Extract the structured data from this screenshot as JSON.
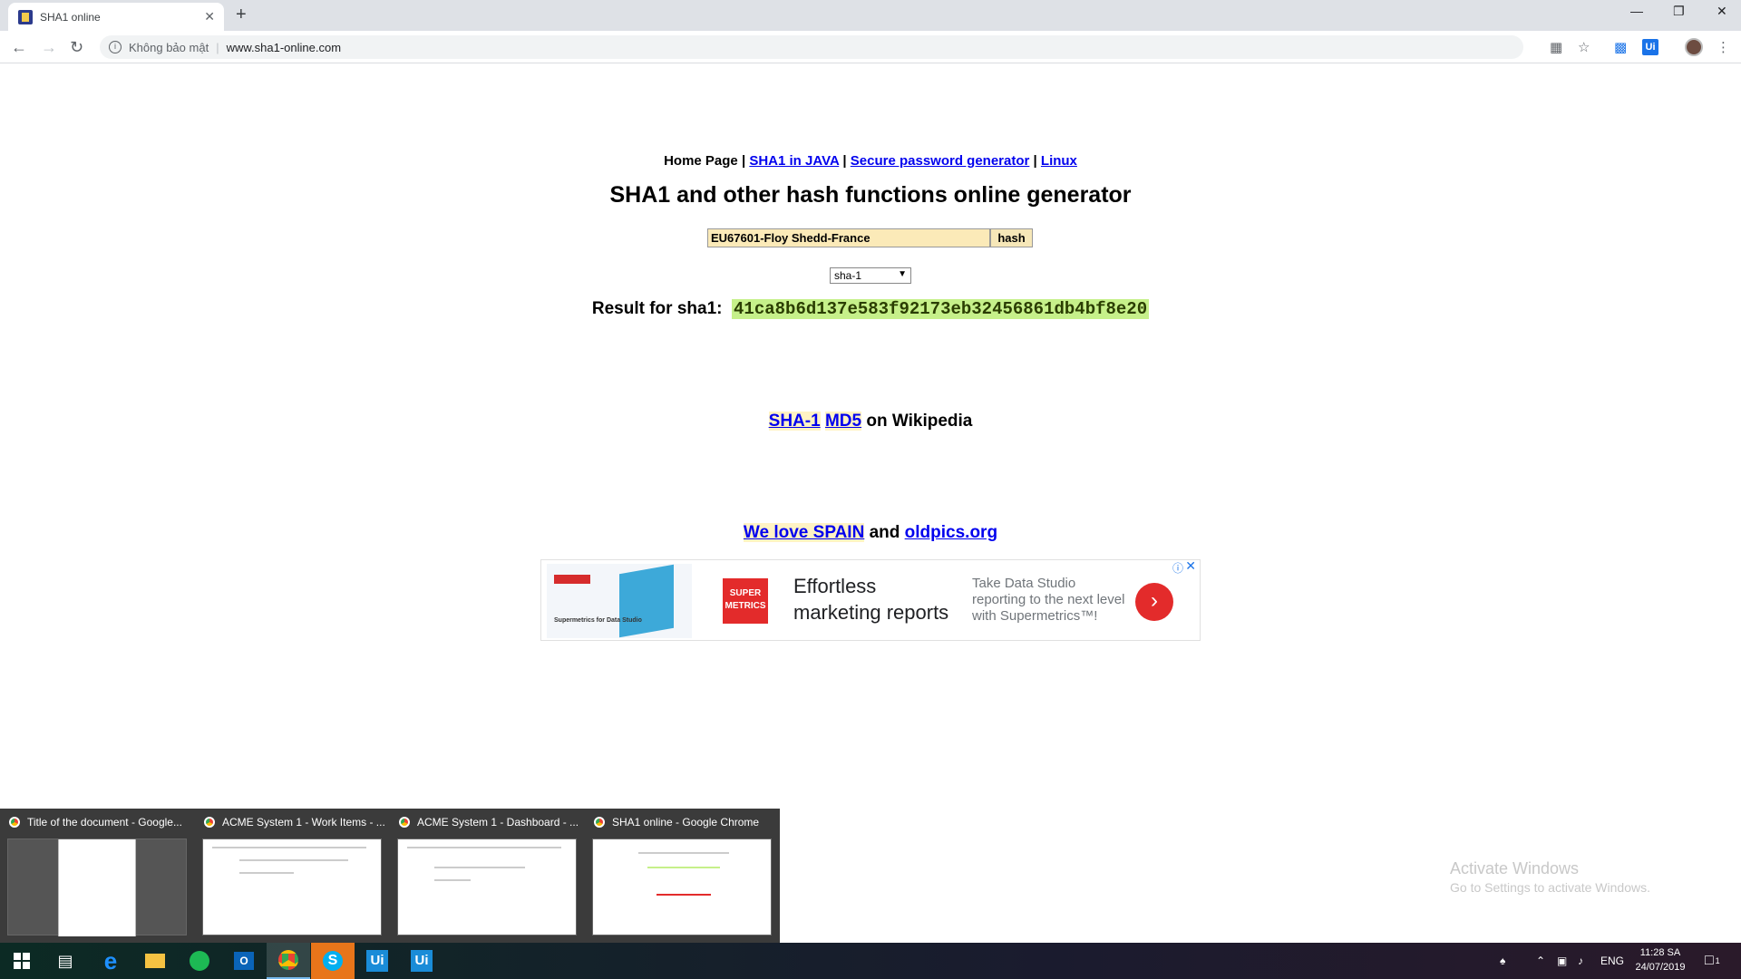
{
  "browser": {
    "tab_title": "SHA1 online",
    "tab_close": "✕",
    "new_tab": "+",
    "security_label": "Không bảo mật",
    "url": "www.sha1-online.com",
    "ext_label": "Ui"
  },
  "page": {
    "nav": {
      "home": "Home Page",
      "sep": "|",
      "sha1_java": "SHA1 in JAVA",
      "password_gen": "Secure password generator",
      "linux": "Linux"
    },
    "title": "SHA1 and other hash functions online generator",
    "input_value": "EU67601-Floy Shedd-France",
    "hash_button": "hash",
    "algorithm_selected": "sha-1",
    "result_label": "Result for sha1:",
    "result_hash": "41ca8b6d137e583f92173eb32456861db4bf8e20",
    "wiki": {
      "sha1": "SHA-1",
      "md5": "MD5",
      "suffix": "on Wikipedia"
    },
    "love": {
      "spain": "We love SPAIN",
      "and": "and",
      "oldpics": "oldpics.org"
    },
    "ad": {
      "thumb_caption": "Supermetrics for Data Studio",
      "logo_text": "SUPER METRICS",
      "headline_line1": "Effortless",
      "headline_line2": "marketing reports",
      "description": "Take Data Studio reporting to the next level with Supermetrics™!",
      "arrow": "›",
      "info": "ⓘ",
      "close": "✕"
    }
  },
  "thumbnails": [
    {
      "label": "Title of the document - Google..."
    },
    {
      "label": "ACME System 1 - Work Items - ..."
    },
    {
      "label": "ACME System 1 - Dashboard - ..."
    },
    {
      "label": "SHA1 online - Google Chrome"
    }
  ],
  "watermark": {
    "line1": "Activate Windows",
    "line2": "Go to Settings to activate Windows."
  },
  "taskbar": {
    "ui1": "Ui",
    "ui2": "Ui",
    "lang": "ENG",
    "time": "11:28 SA",
    "date": "24/07/2019",
    "notification_count": "1"
  },
  "colors": {
    "result_highlight": "#c6f08a",
    "input_bg": "#fbeab8",
    "link": "#0000ee",
    "ad_accent": "#e32b2b"
  }
}
